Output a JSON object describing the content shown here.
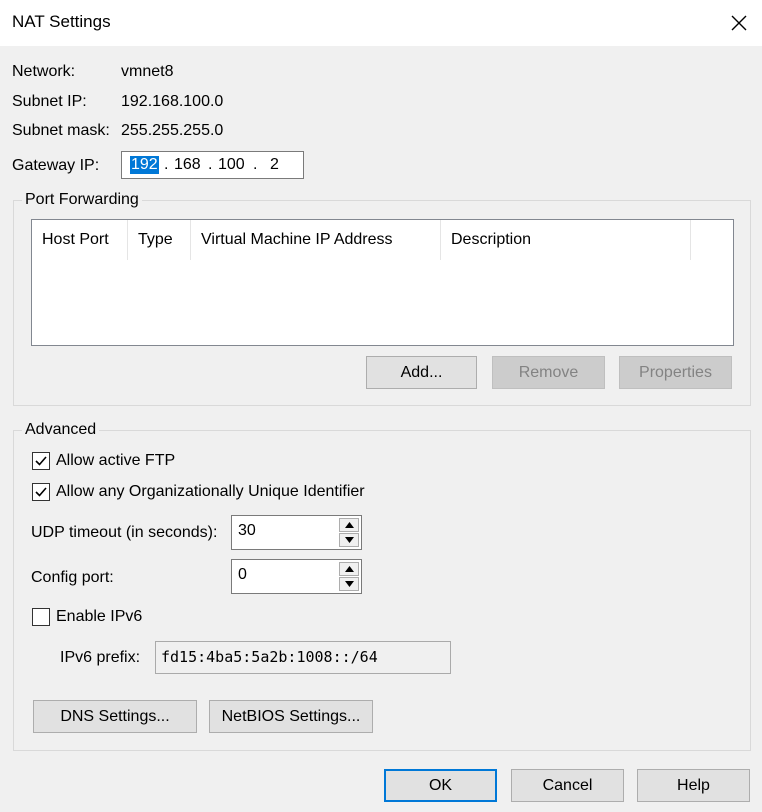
{
  "window": {
    "title": "NAT Settings",
    "close_icon": "close-icon"
  },
  "info": {
    "network_label": "Network:",
    "network_value": "vmnet8",
    "subnet_ip_label": "Subnet IP:",
    "subnet_ip_value": "192.168.100.0",
    "subnet_mask_label": "Subnet mask:",
    "subnet_mask_value": "255.255.255.0",
    "gateway_label": "Gateway IP:",
    "gateway_octets": [
      "192",
      "168",
      "100",
      "2"
    ],
    "gateway_dot": "."
  },
  "port_forwarding": {
    "title": "Port Forwarding",
    "columns": [
      "Host Port",
      "Type",
      "Virtual Machine IP Address",
      "Description"
    ],
    "rows": [],
    "add_label": "Add...",
    "remove_label": "Remove",
    "properties_label": "Properties"
  },
  "advanced": {
    "title": "Advanced",
    "allow_active_ftp": {
      "label": "Allow active FTP",
      "checked": true
    },
    "allow_oui": {
      "label": "Allow any Organizationally Unique Identifier",
      "checked": true
    },
    "udp_timeout_label": "UDP timeout (in seconds):",
    "udp_timeout_value": "30",
    "config_port_label": "Config port:",
    "config_port_value": "0",
    "enable_ipv6": {
      "label": "Enable IPv6",
      "checked": false
    },
    "ipv6_prefix_label": "IPv6 prefix:",
    "ipv6_prefix_value": "fd15:4ba5:5a2b:1008::/64",
    "dns_settings_label": "DNS Settings...",
    "netbios_settings_label": "NetBIOS Settings..."
  },
  "footer": {
    "ok_label": "OK",
    "cancel_label": "Cancel",
    "help_label": "Help"
  },
  "colors": {
    "selection": "#0078d7",
    "default_button_border": "#0078d7",
    "dialog_background": "#f0f0f0"
  }
}
